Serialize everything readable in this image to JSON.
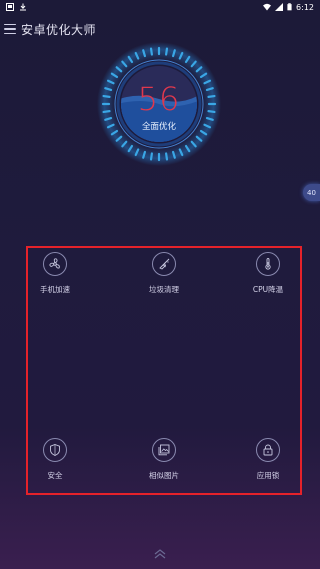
{
  "status_bar": {
    "time": "6:12",
    "icons": [
      "notification-icon",
      "download-icon",
      "wifi-icon",
      "signal-icon",
      "battery-icon"
    ]
  },
  "header": {
    "title": "安卓优化大师",
    "menu_icon": "hamburger-menu-icon"
  },
  "gauge": {
    "score": "56",
    "action_label": "全面优化",
    "score_color": "#e0384d",
    "ring_color": "#3aa7e6"
  },
  "floating_bubble": {
    "value": "40"
  },
  "tools": [
    {
      "label": "手机加速",
      "icon": "fan-icon"
    },
    {
      "label": "垃圾清理",
      "icon": "broom-icon"
    },
    {
      "label": "CPU降温",
      "icon": "thermometer-icon"
    },
    {
      "label": "安全",
      "icon": "shield-icon"
    },
    {
      "label": "相似图片",
      "icon": "image-icon"
    },
    {
      "label": "应用锁",
      "icon": "lock-icon"
    }
  ],
  "colors": {
    "highlight_border": "#e5222a",
    "background": "#1e1b3c",
    "accent": "#3aa7e6"
  }
}
